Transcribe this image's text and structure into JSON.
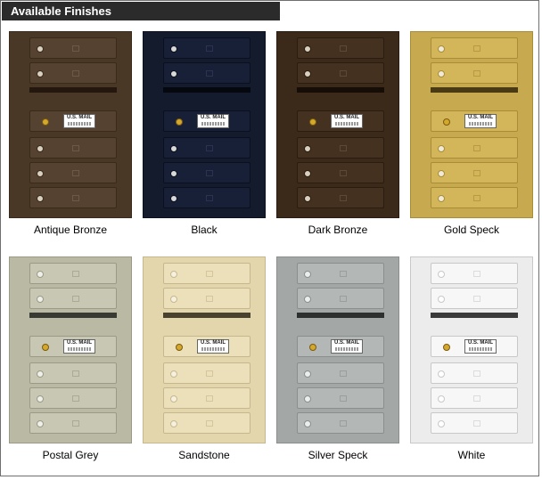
{
  "header": {
    "title": "Available Finishes"
  },
  "usmail_label": "U.S. MAIL",
  "finishes": [
    {
      "name": "Antique Bronze",
      "colors": {
        "body": "#4a3826",
        "door": "#564230",
        "border": "#3a2a1a",
        "slot": "#24180e",
        "slot_text": "#9a8a78",
        "lock": "#d8d0c0",
        "tag": "#6c5a46"
      }
    },
    {
      "name": "Black",
      "colors": {
        "body": "#141b2d",
        "door": "#182038",
        "border": "#0b1020",
        "slot": "#060810",
        "slot_text": "#7a8294",
        "lock": "#d8d8d8",
        "tag": "#2a3350"
      }
    },
    {
      "name": "Dark Bronze",
      "colors": {
        "body": "#3b2a1a",
        "door": "#44311f",
        "border": "#2a1c10",
        "slot": "#150d06",
        "slot_text": "#8a7a66",
        "lock": "#d8d0c0",
        "tag": "#5c4a36"
      }
    },
    {
      "name": "Gold Speck",
      "colors": {
        "body": "#c7a94f",
        "door": "#d4b65a",
        "border": "#a88c38",
        "slot": "#4a3a14",
        "slot_text": "#e8d8a0",
        "lock": "#f0ead8",
        "tag": "#b69a46"
      }
    },
    {
      "name": "Postal Grey",
      "colors": {
        "body": "#b9b9a4",
        "door": "#c7c7b3",
        "border": "#9a9a86",
        "slot": "#3a3a34",
        "slot_text": "#d8d8c8",
        "lock": "#f0f0ea",
        "tag": "#aaaa96"
      }
    },
    {
      "name": "Sandstone",
      "colors": {
        "body": "#e3d6ad",
        "door": "#ece0ba",
        "border": "#c6b88e",
        "slot": "#4a4230",
        "slot_text": "#f2e8c8",
        "lock": "#f6f0e0",
        "tag": "#d4c69c"
      }
    },
    {
      "name": "Silver Speck",
      "colors": {
        "body": "#a3a7a5",
        "door": "#b3b7b5",
        "border": "#8a8e8c",
        "slot": "#2e3030",
        "slot_text": "#d0d4d2",
        "lock": "#eaeeec",
        "tag": "#9a9e9c"
      }
    },
    {
      "name": "White",
      "colors": {
        "body": "#ececec",
        "door": "#f7f7f7",
        "border": "#c8c8c8",
        "slot": "#3a3a3a",
        "slot_text": "#d8d8d8",
        "lock": "#ffffff",
        "tag": "#dcdcdc"
      }
    }
  ]
}
